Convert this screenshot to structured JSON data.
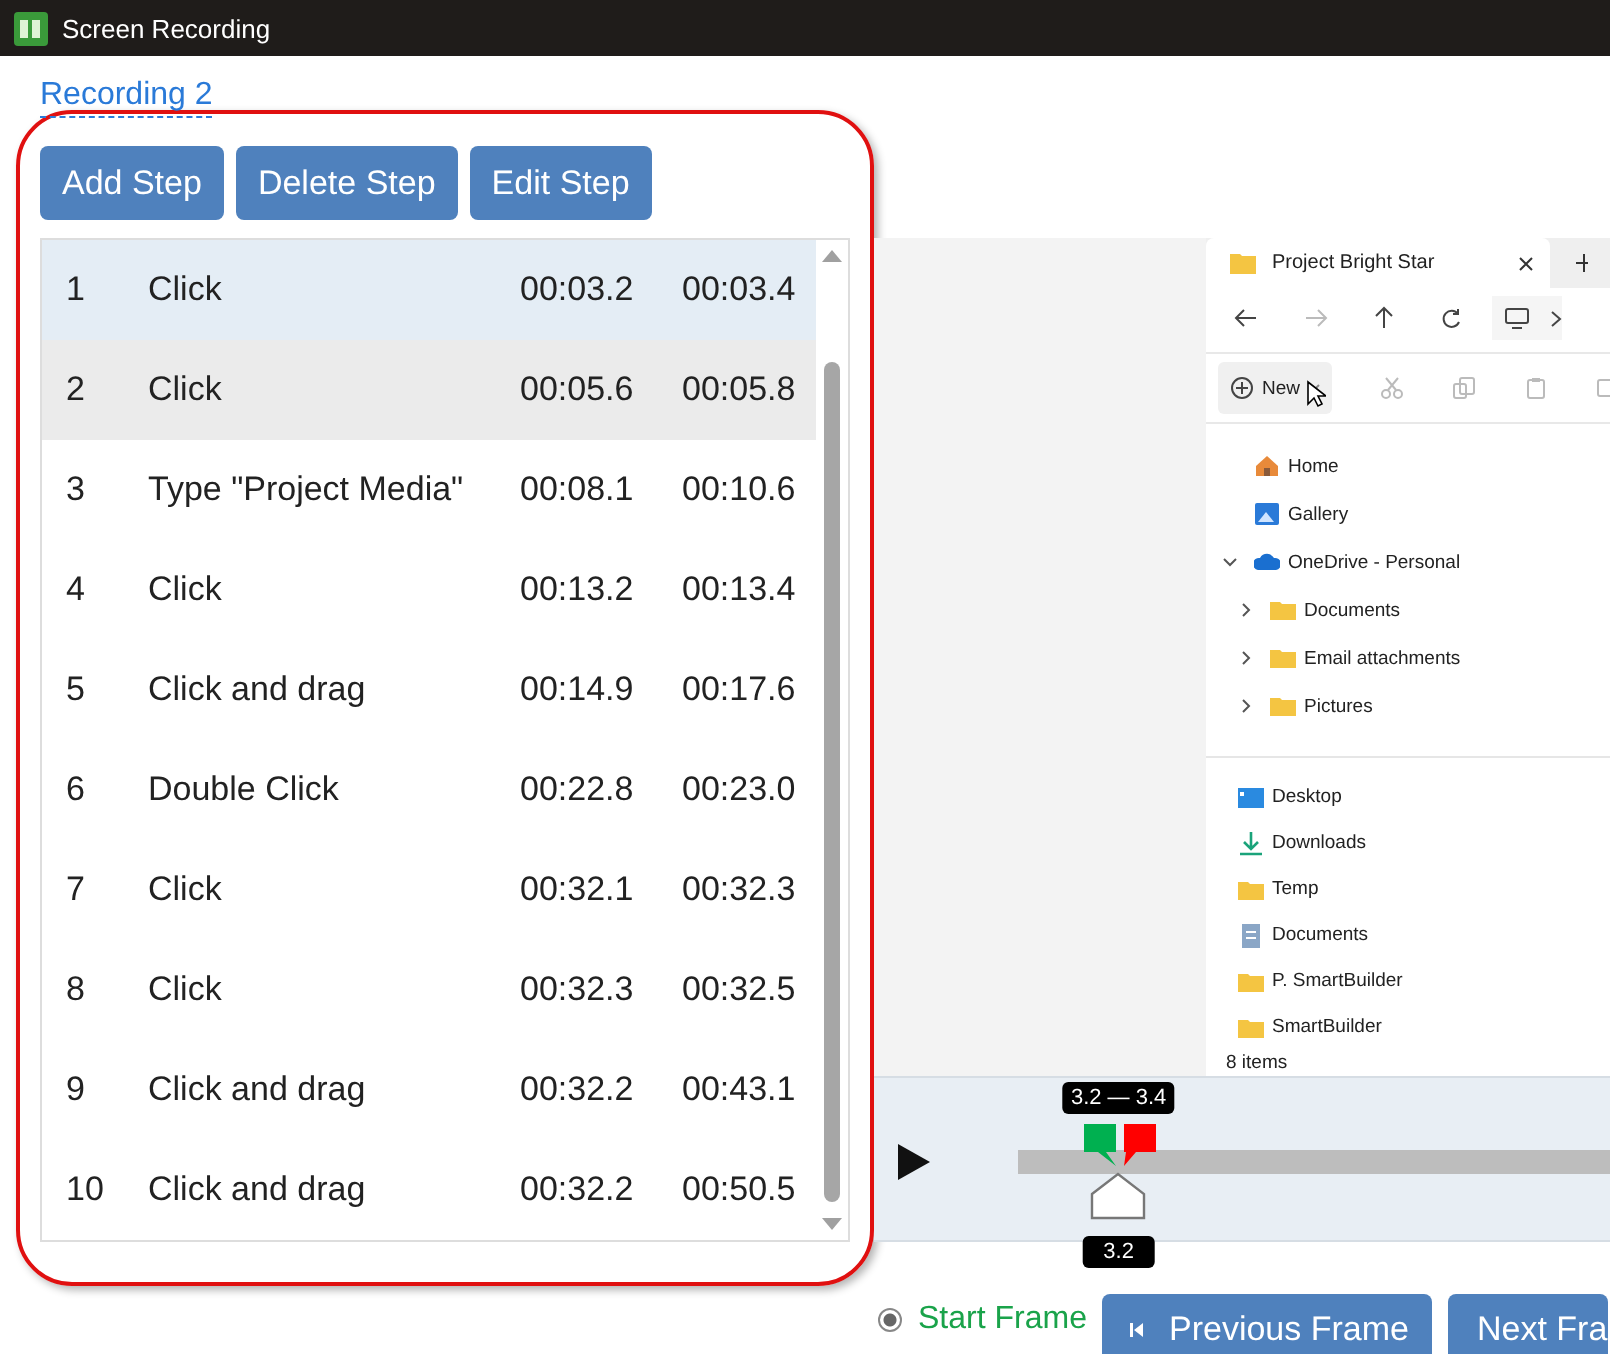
{
  "window": {
    "title": "Screen Recording"
  },
  "recording_title": "Recording 2",
  "toolbar": [
    "Add Step",
    "Delete Step",
    "Edit Step"
  ],
  "steps": [
    {
      "number": "1",
      "action": "Click",
      "start": "00:03.2",
      "end": "00:03.4",
      "selected": true,
      "hovered": false
    },
    {
      "number": "2",
      "action": "Click",
      "start": "00:05.6",
      "end": "00:05.8",
      "selected": false,
      "hovered": true
    },
    {
      "number": "3",
      "action": "Type \"Project Media\"",
      "start": "00:08.1",
      "end": "00:10.6",
      "selected": false,
      "hovered": false
    },
    {
      "number": "4",
      "action": "Click",
      "start": "00:13.2",
      "end": "00:13.4",
      "selected": false,
      "hovered": false
    },
    {
      "number": "5",
      "action": "Click and drag",
      "start": "00:14.9",
      "end": "00:17.6",
      "selected": false,
      "hovered": false
    },
    {
      "number": "6",
      "action": "Double Click",
      "start": "00:22.8",
      "end": "00:23.0",
      "selected": false,
      "hovered": false
    },
    {
      "number": "7",
      "action": "Click",
      "start": "00:32.1",
      "end": "00:32.3",
      "selected": false,
      "hovered": false
    },
    {
      "number": "8",
      "action": "Click",
      "start": "00:32.3",
      "end": "00:32.5",
      "selected": false,
      "hovered": false
    },
    {
      "number": "9",
      "action": "Click and drag",
      "start": "00:32.2",
      "end": "00:43.1",
      "selected": false,
      "hovered": false
    },
    {
      "number": "10",
      "action": "Click and drag",
      "start": "00:32.2",
      "end": "00:50.5",
      "selected": false,
      "hovered": false
    }
  ],
  "preview": {
    "tab_title": "Project Bright Star",
    "new_button": "New",
    "nav_tree": [
      {
        "label": "Home",
        "kind": "home"
      },
      {
        "label": "Gallery",
        "kind": "gallery"
      },
      {
        "label": "OneDrive - Personal",
        "kind": "cloud",
        "expanded": true,
        "children": [
          {
            "label": "Documents",
            "kind": "folder",
            "expanded": false
          },
          {
            "label": "Email attachments",
            "kind": "folder",
            "expanded": false
          },
          {
            "label": "Pictures",
            "kind": "folder",
            "expanded": false
          }
        ]
      }
    ],
    "quick_access": [
      {
        "label": "Desktop",
        "kind": "desktop"
      },
      {
        "label": "Downloads",
        "kind": "download"
      },
      {
        "label": "Temp",
        "kind": "folder"
      },
      {
        "label": "Documents",
        "kind": "document"
      },
      {
        "label": "P. SmartBuilder",
        "kind": "folder"
      },
      {
        "label": "SmartBuilder",
        "kind": "folder"
      }
    ],
    "status": "8 items"
  },
  "timeline": {
    "range_label": "3.2 — 3.4",
    "position_label": "3.2",
    "level": 0.17
  },
  "frame_option": {
    "label": "Start Frame",
    "selected": true
  },
  "frame_buttons": [
    "Previous Frame",
    "Next Fra"
  ]
}
